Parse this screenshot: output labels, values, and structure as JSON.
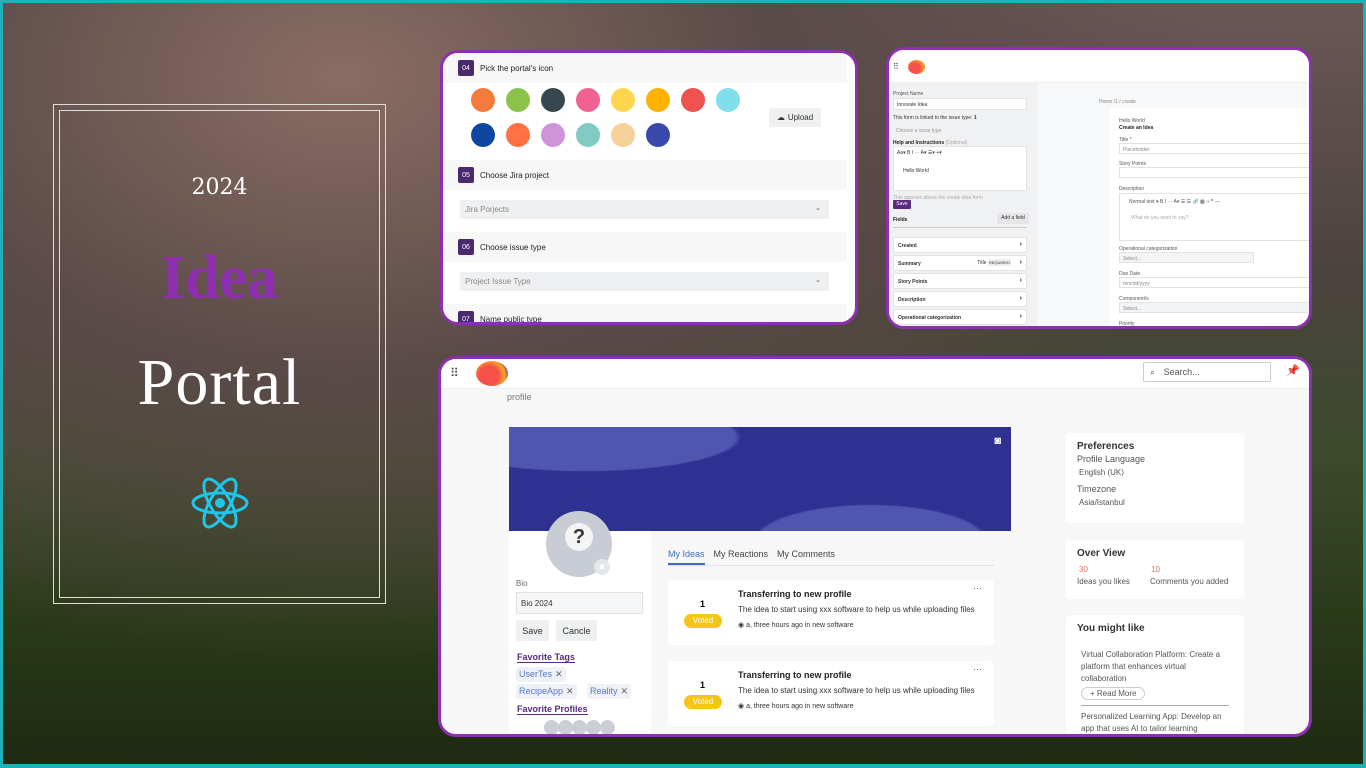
{
  "poster": {
    "year": "2024",
    "title_1": "Idea",
    "title_2": "Portal",
    "accent": "#8e2fb0",
    "icon": "react-atom-icon"
  },
  "setup": {
    "steps": [
      {
        "num": "04",
        "label": "Pick the portal's icon"
      },
      {
        "num": "05",
        "label": "Choose Jira project"
      },
      {
        "num": "06",
        "label": "Choose issue type"
      },
      {
        "num": "07",
        "label": "Name public type"
      }
    ],
    "upload_label": "Upload",
    "jira_placeholder": "Jira Porjects",
    "issue_placeholder": "Project Issue Type",
    "icon_colors": [
      "#f47b3c",
      "#8bc34a",
      "#37474f",
      "#f06292",
      "#ffd54f",
      "#ffb300",
      "#ef5350",
      "#80deea",
      "#0d47a1",
      "#ff7043",
      "#ce93d8",
      "#80cbc4",
      "#f5d19a",
      "#3949ab"
    ]
  },
  "editor": {
    "project_name_label": "Project Name",
    "project_name": "Innovate Idea",
    "linked_text": "This form is linked to the issue type:",
    "linked_value": "1",
    "issue_placeholder": "Choose a issue type",
    "help_label": "Help and Instructions",
    "help_optional": "(Optional)",
    "toolbar": "Aa▾  B I ⋯  A▾  ☰▾  +▾",
    "help_text": "Hello World",
    "help_hint": "This appears above the create idea form",
    "save": "Save",
    "fields_label": "Fields",
    "add_field": "Add a field",
    "fields": [
      "Created",
      "Summary",
      "Story Points",
      "Description",
      "Operational categorization"
    ],
    "summary_title": "Title",
    "summary_badge": "REQUIRED",
    "breadcrumb": "Home  /1  / create",
    "form": {
      "kicker": "Hello World",
      "title": "Create an Idea",
      "title_label": "Title *",
      "title_placeholder": "Placeholder",
      "story_label": "Story Points",
      "desc_label": "Description",
      "desc_toolbar": "Normal text ▾   B I ⋯   A▾   ☰ ☰   🔗 ▦ ‹› ❞ —",
      "desc_placeholder": "What do you want to say?",
      "op_label": "Operational categorization",
      "op_placeholder": "Select...",
      "due_label": "Due Date",
      "due_placeholder": "mm/dd/yyyy",
      "comp_label": "Component/s",
      "comp_placeholder": "Select...",
      "priority_label": "Priority"
    }
  },
  "profile": {
    "search_placeholder": "Search...",
    "breadcrumb": "profile",
    "bio_label": "Bio",
    "bio_value": "Bio 2024",
    "save": "Save",
    "cancel": "Cancle",
    "fav_tags_label": "Favorite Tags",
    "tags": [
      "UserTes",
      "RecipeApp",
      "Reality"
    ],
    "fav_profiles_label": "Favorite Profiles",
    "tabs": [
      "My Ideas",
      "My Reactions",
      "My Comments"
    ],
    "ideas": [
      {
        "votes": "1",
        "badge": "Voted",
        "title": "Transferring to new profile",
        "desc": "The idea to start using xxx software to help us while uploading files",
        "meta": "a, three hours ago in new software"
      },
      {
        "votes": "1",
        "badge": "Voted",
        "title": "Transferring to new profile",
        "desc": "The idea to start using xxx software to help us while uploading files",
        "meta": "a, three hours ago in new software"
      }
    ],
    "preferences": {
      "title": "Preferences",
      "lang_label": "Profile Language",
      "lang": "English (UK)",
      "tz_label": "Timezone",
      "tz": "Asia/Istanbul"
    },
    "overview": {
      "title": "Over View",
      "ideas_count": "30",
      "ideas_label": "Ideas you likes",
      "comments_count": "10",
      "comments_label": "Comments you added"
    },
    "suggest": {
      "title": "You might like",
      "items": [
        "Virtual Collaboration Platform: Create a platform that enhances virtual collaboration",
        "Personalized Learning App: Develop an app that uses AI to tailor learning"
      ],
      "read_more": "+ Read More"
    }
  }
}
